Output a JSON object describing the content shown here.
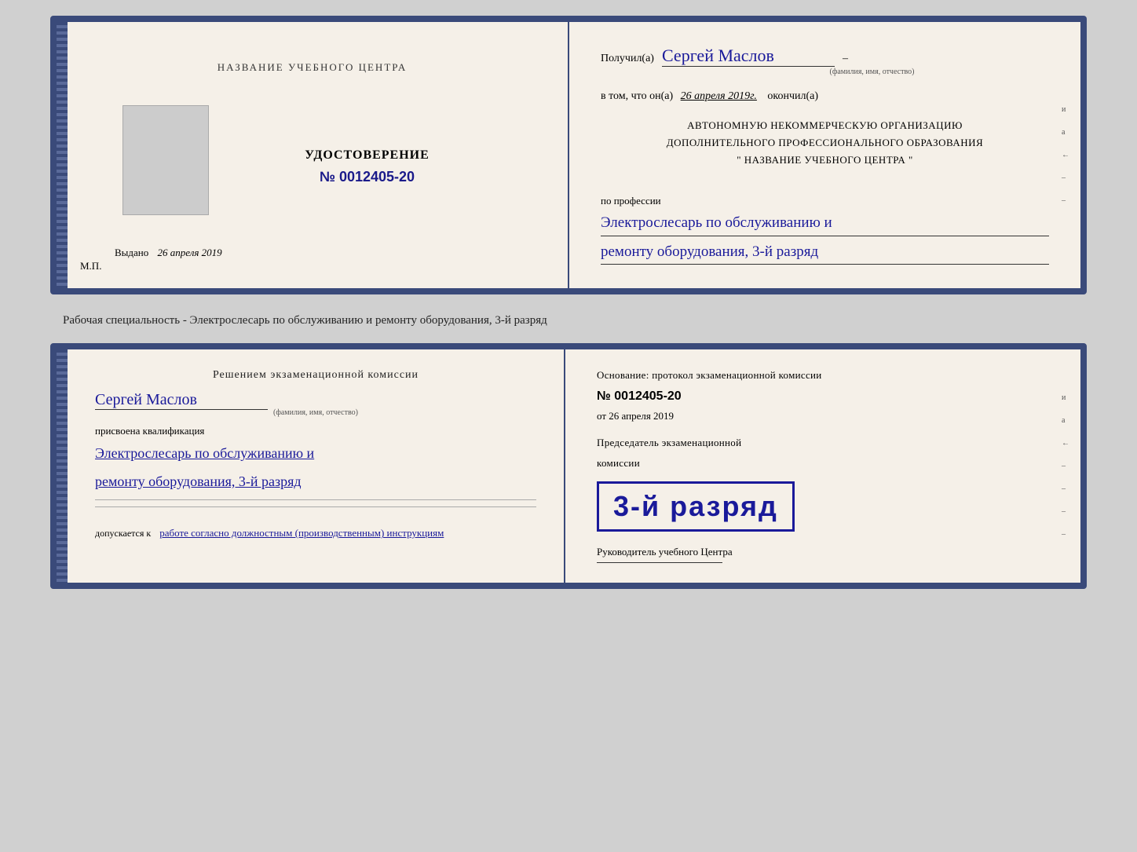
{
  "card1": {
    "left": {
      "top_title": "НАЗВАНИЕ УЧЕБНОГО ЦЕНТРА",
      "cert_label": "УДОСТОВЕРЕНИЕ",
      "cert_number": "№ 0012405-20",
      "issued_label": "Выдано",
      "issued_date": "26 апреля 2019",
      "mp_label": "М.П."
    },
    "right": {
      "received_label": "Получил(а)",
      "recipient_name": "Сергей Маслов",
      "name_subtitle": "(фамилия, имя, отчество)",
      "dash": "–",
      "in_that_label": "в том, что он(а)",
      "date_handwritten": "26 апреля 2019г.",
      "finished_label": "окончил(а)",
      "org_line1": "АВТОНОМНУЮ НЕКОММЕРЧЕСКУЮ ОРГАНИЗАЦИЮ",
      "org_line2": "ДОПОЛНИТЕЛЬНОГО ПРОФЕССИОНАЛЬНОГО ОБРАЗОВАНИЯ",
      "org_line3": "\"   НАЗВАНИЕ УЧЕБНОГО ЦЕНТРА   \"",
      "profession_label": "по профессии",
      "profession_line1": "Электрослесарь по обслуживанию и",
      "profession_line2": "ремонту оборудования, 3-й разряд"
    }
  },
  "caption": {
    "text": "Рабочая специальность - Электрослесарь по обслуживанию и ремонту оборудования, 3-й разряд"
  },
  "card2": {
    "left": {
      "decision_title": "Решением экзаменационной комиссии",
      "name_handwritten": "Сергей Маслов",
      "name_subtitle": "(фамилия, имя, отчество)",
      "assigned_label": "присвоена квалификация",
      "qualification_line1": "Электрослесарь по обслуживанию и",
      "qualification_line2": "ремонту оборудования, 3-й разряд",
      "allowed_label": "допускается к",
      "allowed_handwritten": "работе согласно должностным (производственным) инструкциям"
    },
    "right": {
      "basis_label": "Основание: протокол экзаменационной комиссии",
      "number_label": "№ 0012405-20",
      "date_label": "от 26 апреля 2019",
      "chairman_line1": "Председатель экзаменационной",
      "chairman_line2": "комиссии",
      "stamp_text": "3-й разряд",
      "director_label": "Руководитель учебного Центра"
    }
  },
  "side_decorators": {
    "items": [
      "и",
      "а",
      "←",
      "–",
      "–",
      "–",
      "–"
    ]
  }
}
